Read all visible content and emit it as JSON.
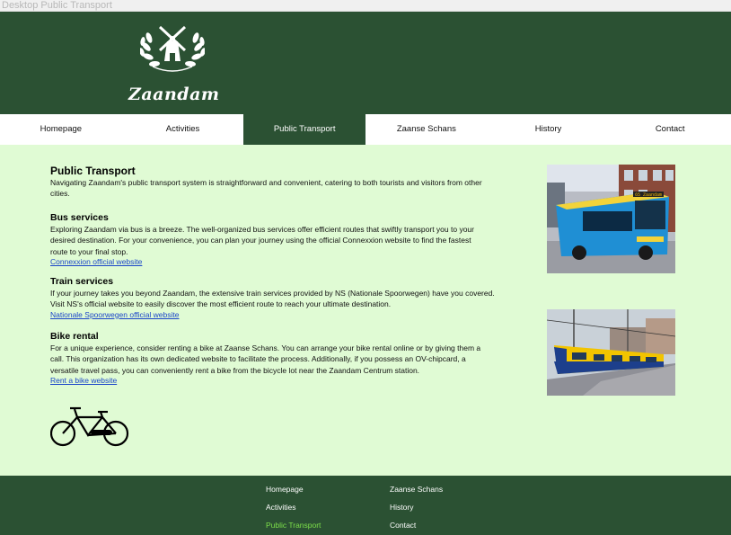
{
  "window": {
    "title": "Desktop Public Transport"
  },
  "header": {
    "logo_text": "Zaandam"
  },
  "nav": {
    "items": [
      "Homepage",
      "Activities",
      "Public Transport",
      "Zaanse Schans",
      "History",
      "Contact"
    ],
    "active": "Public Transport"
  },
  "main": {
    "intro": {
      "heading": "Public Transport",
      "text": "Navigating Zaandam's public transport system is straightforward and convenient, catering to both tourists and visitors from other cities."
    },
    "bus": {
      "heading": "Bus services",
      "text": "Exploring Zaandam via bus is a breeze. The well-organized bus services offer efficient routes that swiftly transport you to your desired destination. For your convenience, you can plan your journey using the official Connexxion website to find the fastest route to your final stop.",
      "link": "Connexxion official website"
    },
    "train": {
      "heading": "Train services",
      "text": "If your journey takes you beyond Zaandam, the extensive train services provided by NS (Nationale Spoorwegen) have you covered. Visit NS's official website to easily discover the most efficient route to reach your ultimate destination.",
      "link": "Nationale Spoorwegen official website"
    },
    "bike": {
      "heading": "Bike rental",
      "text": "For a unique experience, consider renting a bike at Zaanse Schans. You can arrange your bike rental online or by giving them a call. This organization has its own dedicated website to facilitate the process. Additionally, if you possess an OV-chipcard, a versatile travel pass, you can conveniently rent a bike from the bicycle lot near the Zaandam Centrum station.",
      "link": "Rent a bike website"
    }
  },
  "photos": {
    "bus_sign": "65 Zaandam",
    "icons": [
      "windmill-logo-icon",
      "bicycle-icon"
    ]
  },
  "footer": {
    "col1": [
      "Homepage",
      "Activities",
      "Public Transport"
    ],
    "col2": [
      "Zaanse Schans",
      "History",
      "Contact"
    ],
    "active": "Public Transport"
  },
  "colors": {
    "header_bg": "#2b5133",
    "page_bg": "#e0fbd4",
    "link": "#1a45c9",
    "footer_active": "#7de04a"
  }
}
